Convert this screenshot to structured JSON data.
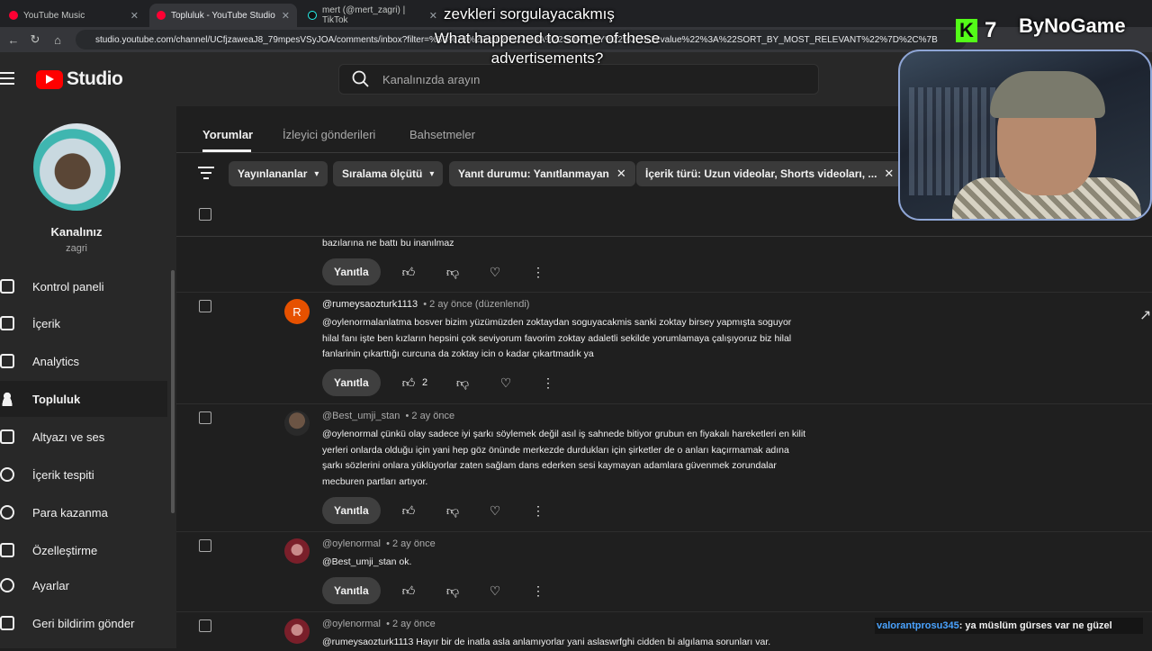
{
  "browser": {
    "tabs": [
      {
        "label": "YouTube Music",
        "active": false
      },
      {
        "label": "Topluluk - YouTube Studio",
        "active": true
      },
      {
        "label": "mert (@mert_zagri) | TikTok",
        "active": false
      }
    ],
    "url": "studio.youtube.com/channel/UCfjzaweaJ8_79mpesVSyJOA/comments/inbox?filter=%5B%7B%22name%22%3A%22SORT_BY%22%2C%22value%22%3A%22SORT_BY_MOST_RELEVANT%22%7D%2C%7B"
  },
  "header": {
    "logo_text": "Studio",
    "search_placeholder": "Kanalınızda arayın"
  },
  "sidebar": {
    "channel_name": "Kanalınız",
    "channel_handle": "zagri",
    "items": [
      {
        "label": "Kontrol paneli",
        "icon": "dashboard-icon",
        "selected": false
      },
      {
        "label": "İçerik",
        "icon": "content-icon",
        "selected": false
      },
      {
        "label": "Analytics",
        "icon": "analytics-icon",
        "selected": false
      },
      {
        "label": "Topluluk",
        "icon": "community-icon",
        "selected": true
      },
      {
        "label": "Altyazı ve ses",
        "icon": "subtitles-icon",
        "selected": false
      },
      {
        "label": "İçerik tespiti",
        "icon": "copyright-icon",
        "selected": false
      },
      {
        "label": "Para kazanma",
        "icon": "monetization-icon",
        "selected": false
      },
      {
        "label": "Özelleştirme",
        "icon": "customization-icon",
        "selected": false
      },
      {
        "label": "Ayarlar",
        "icon": "settings-icon",
        "selected": false
      },
      {
        "label": "Geri bildirim gönder",
        "icon": "feedback-icon",
        "selected": false
      }
    ]
  },
  "tabs": [
    {
      "label": "Yorumlar",
      "active": true
    },
    {
      "label": "İzleyici gönderileri",
      "active": false
    },
    {
      "label": "Bahsetmeler",
      "active": false
    }
  ],
  "filters": [
    {
      "label": "Yayınlananlar",
      "control": "dropdown"
    },
    {
      "label": "Sıralama ölçütü",
      "control": "dropdown"
    },
    {
      "label": "Yanıt durumu: Yanıtlanmayan",
      "control": "remove"
    },
    {
      "label": "İçerik türü: Uzun videolar, Shorts videoları, ...",
      "control": "remove"
    }
  ],
  "reply_label": "Yanıtla",
  "comments": [
    {
      "author": "",
      "time": "",
      "text": "bazılarına ne battı bu inanılmaz",
      "likes": ""
    },
    {
      "author": "@rumeysaozturk1113",
      "time": "• 2 ay önce (düzenlendi)",
      "avatar_letter": "R",
      "avatar_color": "#e65100",
      "text": "@oylenormalanlatma bosver  bizim yüzümüzden zoktaydan soguyacakmis sanki zoktay birsey yapmışta soguyor hilal fanı işte ben kızların hepsini çok seviyorum  favorim zoktay adaletli sekilde yorumlamaya çalışıyoruz biz hilal fanlarinin çıkarttığı curcuna da zoktay icin o kadar çıkartmadık ya",
      "likes": "2"
    },
    {
      "author": "@Best_umji_stan",
      "time": "• 2 ay önce",
      "text": "@oylenormal çünkü olay sadece iyi şarkı söylemek değil asıl iş sahnede bitiyor grubun en fiyakalı hareketleri en kilit yerleri onlarda olduğu için yani hep göz önünde merkezde durdukları için şirketler de o anları kaçırmamak adına şarkı sözlerini onlara yüklüyorlar zaten sağlam dans ederken sesi kaymayan adamlara güvenmek zorundalar mecburen partları artıyor.",
      "likes": ""
    },
    {
      "author": "@oylenormal",
      "time": "• 2 ay önce",
      "text": "@Best_umji_stan ok.",
      "likes": ""
    },
    {
      "author": "@oylenormal",
      "time": "• 2 ay önce",
      "text": "@rumeysaozturk1113 Hayır bir de inatla asla anlamıyorlar yani aslaswrfghi cidden bi algılama sorunları var.",
      "likes": ""
    }
  ],
  "overlay": {
    "subtitle_top": "zevkleri sorgulayacakmış",
    "subtitle_translation": "What happened to some of these advertisements?",
    "kick_count": "7",
    "watermark": "ByNoGame",
    "chat_user": "valorantprosu345",
    "chat_message": ": ya müslüm gürses var ne güzel"
  }
}
